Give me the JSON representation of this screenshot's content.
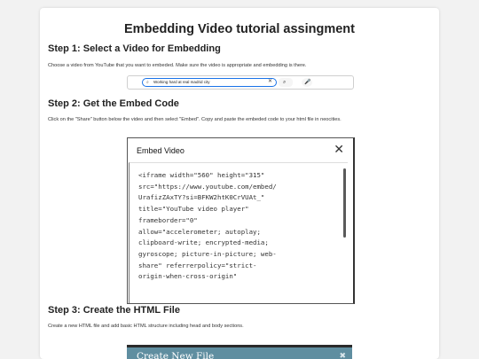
{
  "page": {
    "title": "Embedding Video tutorial assingment"
  },
  "step1": {
    "heading": "Step 1: Select a Video for Embedding",
    "text": "Choose a video from YouTube that you want to embeded. Make sure the video is appropriate and embedding is there."
  },
  "search": {
    "query": "Working hard at real madrid city",
    "search_icon": "search-icon",
    "clear_icon": "close-icon",
    "mic_icon": "microphone-icon"
  },
  "step2": {
    "heading": "Step 2: Get the Embed Code",
    "text": "Click on the \"Share\" button below the video and then select \"Embed\". Copy and paste the embeded code to your html file in neocities."
  },
  "embed": {
    "title": "Embed Video",
    "close_icon": "close-icon",
    "code": "<iframe width=\"560\" height=\"315\"\nsrc=\"https://www.youtube.com/embed/\nUrafizZAxTY?si=BFKW2htK0CrVUAt_\"\ntitle=\"YouTube video player\"\nframeborder=\"0\"\nallow=\"accelerometer; autoplay;\nclipboard-write; encrypted-media;\ngyroscope; picture-in-picture; web-\nshare\" referrerpolicy=\"strict-\norigin-when-cross-origin\""
  },
  "step3": {
    "heading": "Step 3: Create the HTML File",
    "text": "Create a new HTML file and add basic HTML structure including head and body sections."
  },
  "newfile": {
    "title": "Create New File",
    "close_glyph": "✖"
  }
}
